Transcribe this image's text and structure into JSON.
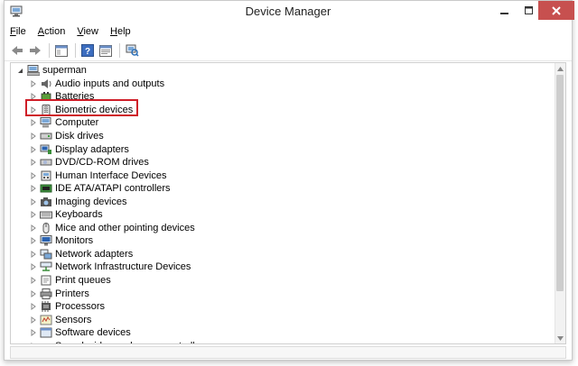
{
  "window": {
    "title": "Device Manager"
  },
  "menu": [
    {
      "key": "F",
      "rest": "ile"
    },
    {
      "key": "A",
      "rest": "ction"
    },
    {
      "key": "V",
      "rest": "iew"
    },
    {
      "key": "H",
      "rest": "elp"
    }
  ],
  "tree": {
    "root": "superman",
    "items": [
      {
        "label": "Audio inputs and outputs",
        "icon": "speaker-icon"
      },
      {
        "label": "Batteries",
        "icon": "battery-icon"
      },
      {
        "label": "Biometric devices",
        "icon": "fingerprint-icon"
      },
      {
        "label": "Computer",
        "icon": "computer-icon"
      },
      {
        "label": "Disk drives",
        "icon": "disk-drive-icon"
      },
      {
        "label": "Display adapters",
        "icon": "display-adapter-icon"
      },
      {
        "label": "DVD/CD-ROM drives",
        "icon": "dvd-drive-icon"
      },
      {
        "label": "Human Interface Devices",
        "icon": "hid-icon"
      },
      {
        "label": "IDE ATA/ATAPI controllers",
        "icon": "ide-controller-icon"
      },
      {
        "label": "Imaging devices",
        "icon": "camera-icon"
      },
      {
        "label": "Keyboards",
        "icon": "keyboard-icon"
      },
      {
        "label": "Mice and other pointing devices",
        "icon": "mouse-icon"
      },
      {
        "label": "Monitors",
        "icon": "monitor-icon"
      },
      {
        "label": "Network adapters",
        "icon": "network-adapter-icon"
      },
      {
        "label": "Network Infrastructure Devices",
        "icon": "network-infrastructure-icon"
      },
      {
        "label": "Print queues",
        "icon": "print-queue-icon"
      },
      {
        "label": "Printers",
        "icon": "printer-icon"
      },
      {
        "label": "Processors",
        "icon": "processor-icon"
      },
      {
        "label": "Sensors",
        "icon": "sensor-icon"
      },
      {
        "label": "Software devices",
        "icon": "software-device-icon"
      },
      {
        "label": "Sound, video and game controllers",
        "icon": "sound-controller-icon"
      }
    ]
  },
  "colors": {
    "close_button": "#c7504f",
    "highlight_box": "#cf1e28"
  }
}
